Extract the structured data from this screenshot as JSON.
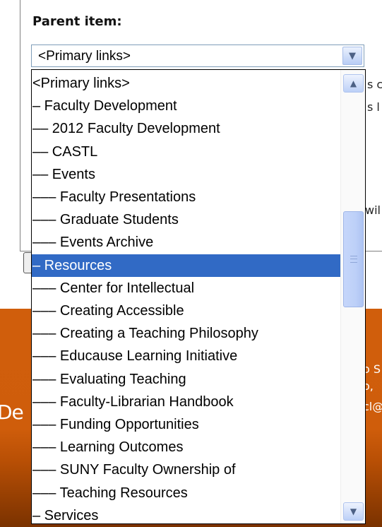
{
  "form": {
    "parent_label": "Parent item:",
    "selected_value": "<Primary links>"
  },
  "dropdown": {
    "options": [
      {
        "text": "<Primary links>",
        "prefix": ""
      },
      {
        "text": "Faculty Development",
        "prefix": "–"
      },
      {
        "text": "2012 Faculty Development",
        "prefix": "––"
      },
      {
        "text": "CASTL",
        "prefix": "––"
      },
      {
        "text": "Events",
        "prefix": "––"
      },
      {
        "text": "Faculty Presentations",
        "prefix": "–––"
      },
      {
        "text": "Graduate Students",
        "prefix": "–––"
      },
      {
        "text": "Events Archive",
        "prefix": "–––"
      },
      {
        "text": "Resources",
        "prefix": "–",
        "selected": true
      },
      {
        "text": "Center for Intellectual",
        "prefix": "–––"
      },
      {
        "text": "Creating Accessible",
        "prefix": "–––"
      },
      {
        "text": "Creating a Teaching Philosophy",
        "prefix": "–––"
      },
      {
        "text": "Educause Learning Initiative",
        "prefix": "–––"
      },
      {
        "text": "Evaluating Teaching",
        "prefix": "–––"
      },
      {
        "text": "Faculty-Librarian Handbook",
        "prefix": "–––"
      },
      {
        "text": "Funding Opportunities",
        "prefix": "–––"
      },
      {
        "text": "Learning Outcomes",
        "prefix": "–––"
      },
      {
        "text": "SUNY Faculty Ownership of",
        "prefix": "–––"
      },
      {
        "text": "Teaching Resources",
        "prefix": "–––"
      },
      {
        "text": "Services",
        "prefix": "–"
      }
    ]
  },
  "behind": {
    "text_1": "s c",
    "text_2": "s l",
    "text_3": "wil",
    "button_label": "S"
  },
  "footer": {
    "left_fragment": "De",
    "right_1": "o S",
    "right_2": "o,",
    "right_3": "cl@"
  },
  "colors": {
    "selection": "#316ac5",
    "footer_orange": "#cf5d0b"
  }
}
